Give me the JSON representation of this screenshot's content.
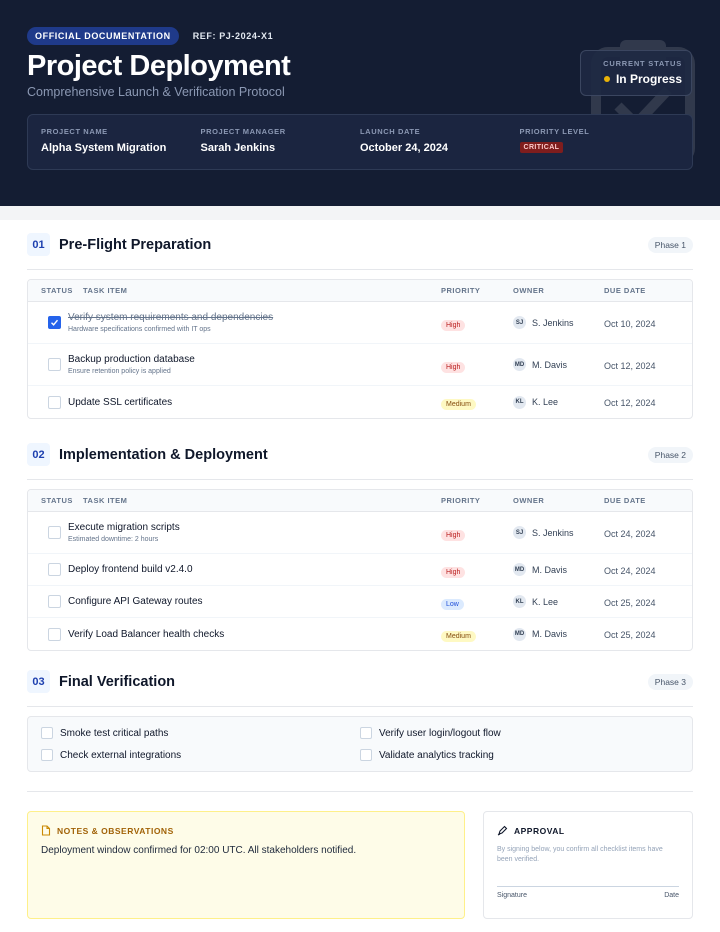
{
  "header": {
    "badge": "OFFICIAL DOCUMENTATION",
    "ref": "REF: PJ-2024-X1",
    "title": "Project Deployment",
    "subtitle": "Comprehensive Launch & Verification Protocol",
    "status_label": "CURRENT STATUS",
    "status_value": "In Progress",
    "meta": [
      {
        "label": "PROJECT NAME",
        "value": "Alpha System Migration"
      },
      {
        "label": "PROJECT MANAGER",
        "value": "Sarah Jenkins"
      },
      {
        "label": "LAUNCH DATE",
        "value": "October 24, 2024"
      },
      {
        "label": "PRIORITY LEVEL",
        "value": "CRITICAL"
      }
    ]
  },
  "table_headers": {
    "status": "STATUS",
    "task": "TASK ITEM",
    "priority": "PRIORITY",
    "owner": "OWNER",
    "due": "DUE DATE"
  },
  "sections": [
    {
      "num": "01",
      "title": "Pre-Flight Preparation",
      "phase": "Phase 1",
      "rows": [
        {
          "task": "Verify system requirements and dependencies",
          "note": "Hardware specifications confirmed with IT ops",
          "checked": true,
          "priority": "High",
          "initials": "SJ",
          "owner": "S. Jenkins",
          "due": "Oct 10, 2024"
        },
        {
          "task": "Backup production database",
          "note": "Ensure retention policy is applied",
          "checked": false,
          "priority": "High",
          "initials": "MD",
          "owner": "M. Davis",
          "due": "Oct 12, 2024"
        },
        {
          "task": "Update SSL certificates",
          "note": "",
          "checked": false,
          "priority": "Medium",
          "initials": "KL",
          "owner": "K. Lee",
          "due": "Oct 12, 2024"
        }
      ]
    },
    {
      "num": "02",
      "title": "Implementation & Deployment",
      "phase": "Phase 2",
      "rows": [
        {
          "task": "Execute migration scripts",
          "note": "Estimated downtime: 2 hours",
          "checked": false,
          "priority": "High",
          "initials": "SJ",
          "owner": "S. Jenkins",
          "due": "Oct 24, 2024"
        },
        {
          "task": "Deploy frontend build v2.4.0",
          "note": "",
          "checked": false,
          "priority": "High",
          "initials": "MD",
          "owner": "M. Davis",
          "due": "Oct 24, 2024"
        },
        {
          "task": "Configure API Gateway routes",
          "note": "",
          "checked": false,
          "priority": "Low",
          "initials": "KL",
          "owner": "K. Lee",
          "due": "Oct 25, 2024"
        },
        {
          "task": "Verify Load Balancer health checks",
          "note": "",
          "checked": false,
          "priority": "Medium",
          "initials": "MD",
          "owner": "M. Davis",
          "due": "Oct 25, 2024"
        }
      ]
    }
  ],
  "final": {
    "num": "03",
    "title": "Final Verification",
    "phase": "Phase 3",
    "items": [
      "Smoke test critical paths",
      "Verify user login/logout flow",
      "Check external integrations",
      "Validate analytics tracking"
    ]
  },
  "notes": {
    "title": "NOTES & OBSERVATIONS",
    "text": "Deployment window confirmed for 02:00 UTC. All stakeholders notified."
  },
  "approval": {
    "title": "APPROVAL",
    "text": "By signing below, you confirm all checklist items have been verified.",
    "signature": "Signature",
    "date": "Date"
  },
  "colors": {
    "header_bg": "#141d33",
    "accent": "#2563eb",
    "status_dot": "#eab308",
    "critical": "#7f1d1d"
  }
}
